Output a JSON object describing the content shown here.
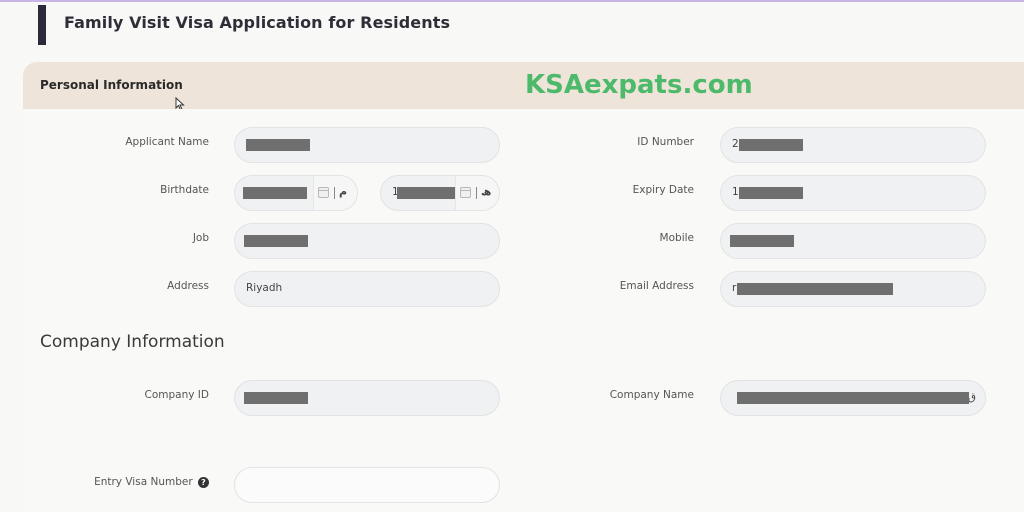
{
  "page": {
    "title": "Family Visit Visa Application for Residents",
    "watermark": "KSAexpats.com",
    "accent_color": "#2b2a3a",
    "watermark_color": "#4cba6a"
  },
  "personal": {
    "section_title": "Personal Information",
    "applicant_name": {
      "label": "Applicant Name",
      "value": ""
    },
    "birthdate": {
      "label": "Birthdate",
      "gregorian_value": "",
      "hijri_value": "1",
      "gregorian_suffix": "م",
      "hijri_suffix": "ھ"
    },
    "job": {
      "label": "Job",
      "value": ""
    },
    "address": {
      "label": "Address",
      "value": "Riyadh"
    },
    "id_number": {
      "label": "ID Number",
      "value": "2"
    },
    "expiry_date": {
      "label": "Expiry Date",
      "value": "1"
    },
    "mobile": {
      "label": "Mobile",
      "value": ""
    },
    "email": {
      "label": "Email Address",
      "value": "r"
    }
  },
  "company": {
    "section_title": "Company Information",
    "company_id": {
      "label": "Company ID",
      "value": ""
    },
    "company_name": {
      "label": "Company Name",
      "value": "ق"
    },
    "entry_visa": {
      "label": "Entry Visa Number",
      "value": "",
      "help_icon": "?"
    }
  }
}
